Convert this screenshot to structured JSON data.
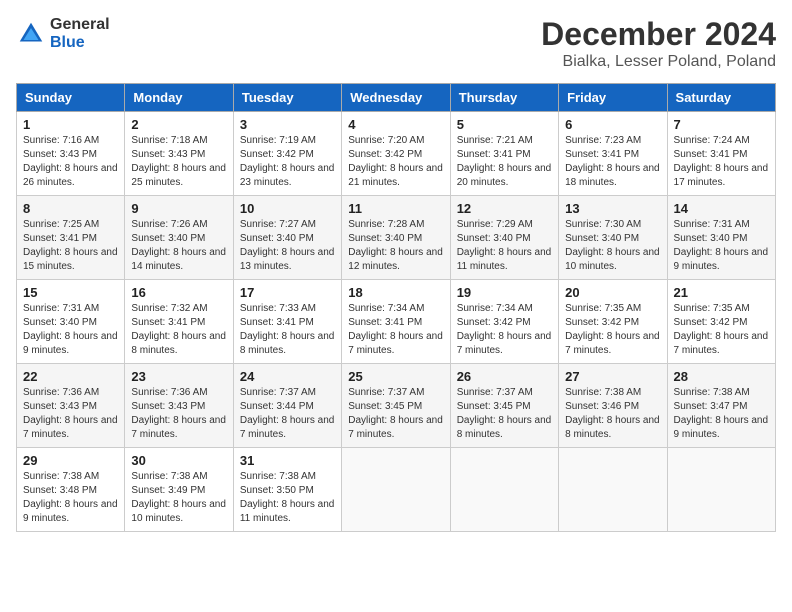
{
  "header": {
    "logo_general": "General",
    "logo_blue": "Blue",
    "title": "December 2024",
    "subtitle": "Bialka, Lesser Poland, Poland"
  },
  "weekdays": [
    "Sunday",
    "Monday",
    "Tuesday",
    "Wednesday",
    "Thursday",
    "Friday",
    "Saturday"
  ],
  "weeks": [
    [
      {
        "day": "1",
        "sunrise": "7:16 AM",
        "sunset": "3:43 PM",
        "daylight": "8 hours and 26 minutes."
      },
      {
        "day": "2",
        "sunrise": "7:18 AM",
        "sunset": "3:43 PM",
        "daylight": "8 hours and 25 minutes."
      },
      {
        "day": "3",
        "sunrise": "7:19 AM",
        "sunset": "3:42 PM",
        "daylight": "8 hours and 23 minutes."
      },
      {
        "day": "4",
        "sunrise": "7:20 AM",
        "sunset": "3:42 PM",
        "daylight": "8 hours and 21 minutes."
      },
      {
        "day": "5",
        "sunrise": "7:21 AM",
        "sunset": "3:41 PM",
        "daylight": "8 hours and 20 minutes."
      },
      {
        "day": "6",
        "sunrise": "7:23 AM",
        "sunset": "3:41 PM",
        "daylight": "8 hours and 18 minutes."
      },
      {
        "day": "7",
        "sunrise": "7:24 AM",
        "sunset": "3:41 PM",
        "daylight": "8 hours and 17 minutes."
      }
    ],
    [
      {
        "day": "8",
        "sunrise": "7:25 AM",
        "sunset": "3:41 PM",
        "daylight": "8 hours and 15 minutes."
      },
      {
        "day": "9",
        "sunrise": "7:26 AM",
        "sunset": "3:40 PM",
        "daylight": "8 hours and 14 minutes."
      },
      {
        "day": "10",
        "sunrise": "7:27 AM",
        "sunset": "3:40 PM",
        "daylight": "8 hours and 13 minutes."
      },
      {
        "day": "11",
        "sunrise": "7:28 AM",
        "sunset": "3:40 PM",
        "daylight": "8 hours and 12 minutes."
      },
      {
        "day": "12",
        "sunrise": "7:29 AM",
        "sunset": "3:40 PM",
        "daylight": "8 hours and 11 minutes."
      },
      {
        "day": "13",
        "sunrise": "7:30 AM",
        "sunset": "3:40 PM",
        "daylight": "8 hours and 10 minutes."
      },
      {
        "day": "14",
        "sunrise": "7:31 AM",
        "sunset": "3:40 PM",
        "daylight": "8 hours and 9 minutes."
      }
    ],
    [
      {
        "day": "15",
        "sunrise": "7:31 AM",
        "sunset": "3:40 PM",
        "daylight": "8 hours and 9 minutes."
      },
      {
        "day": "16",
        "sunrise": "7:32 AM",
        "sunset": "3:41 PM",
        "daylight": "8 hours and 8 minutes."
      },
      {
        "day": "17",
        "sunrise": "7:33 AM",
        "sunset": "3:41 PM",
        "daylight": "8 hours and 8 minutes."
      },
      {
        "day": "18",
        "sunrise": "7:34 AM",
        "sunset": "3:41 PM",
        "daylight": "8 hours and 7 minutes."
      },
      {
        "day": "19",
        "sunrise": "7:34 AM",
        "sunset": "3:42 PM",
        "daylight": "8 hours and 7 minutes."
      },
      {
        "day": "20",
        "sunrise": "7:35 AM",
        "sunset": "3:42 PM",
        "daylight": "8 hours and 7 minutes."
      },
      {
        "day": "21",
        "sunrise": "7:35 AM",
        "sunset": "3:42 PM",
        "daylight": "8 hours and 7 minutes."
      }
    ],
    [
      {
        "day": "22",
        "sunrise": "7:36 AM",
        "sunset": "3:43 PM",
        "daylight": "8 hours and 7 minutes."
      },
      {
        "day": "23",
        "sunrise": "7:36 AM",
        "sunset": "3:43 PM",
        "daylight": "8 hours and 7 minutes."
      },
      {
        "day": "24",
        "sunrise": "7:37 AM",
        "sunset": "3:44 PM",
        "daylight": "8 hours and 7 minutes."
      },
      {
        "day": "25",
        "sunrise": "7:37 AM",
        "sunset": "3:45 PM",
        "daylight": "8 hours and 7 minutes."
      },
      {
        "day": "26",
        "sunrise": "7:37 AM",
        "sunset": "3:45 PM",
        "daylight": "8 hours and 8 minutes."
      },
      {
        "day": "27",
        "sunrise": "7:38 AM",
        "sunset": "3:46 PM",
        "daylight": "8 hours and 8 minutes."
      },
      {
        "day": "28",
        "sunrise": "7:38 AM",
        "sunset": "3:47 PM",
        "daylight": "8 hours and 9 minutes."
      }
    ],
    [
      {
        "day": "29",
        "sunrise": "7:38 AM",
        "sunset": "3:48 PM",
        "daylight": "8 hours and 9 minutes."
      },
      {
        "day": "30",
        "sunrise": "7:38 AM",
        "sunset": "3:49 PM",
        "daylight": "8 hours and 10 minutes."
      },
      {
        "day": "31",
        "sunrise": "7:38 AM",
        "sunset": "3:50 PM",
        "daylight": "8 hours and 11 minutes."
      },
      null,
      null,
      null,
      null
    ]
  ]
}
